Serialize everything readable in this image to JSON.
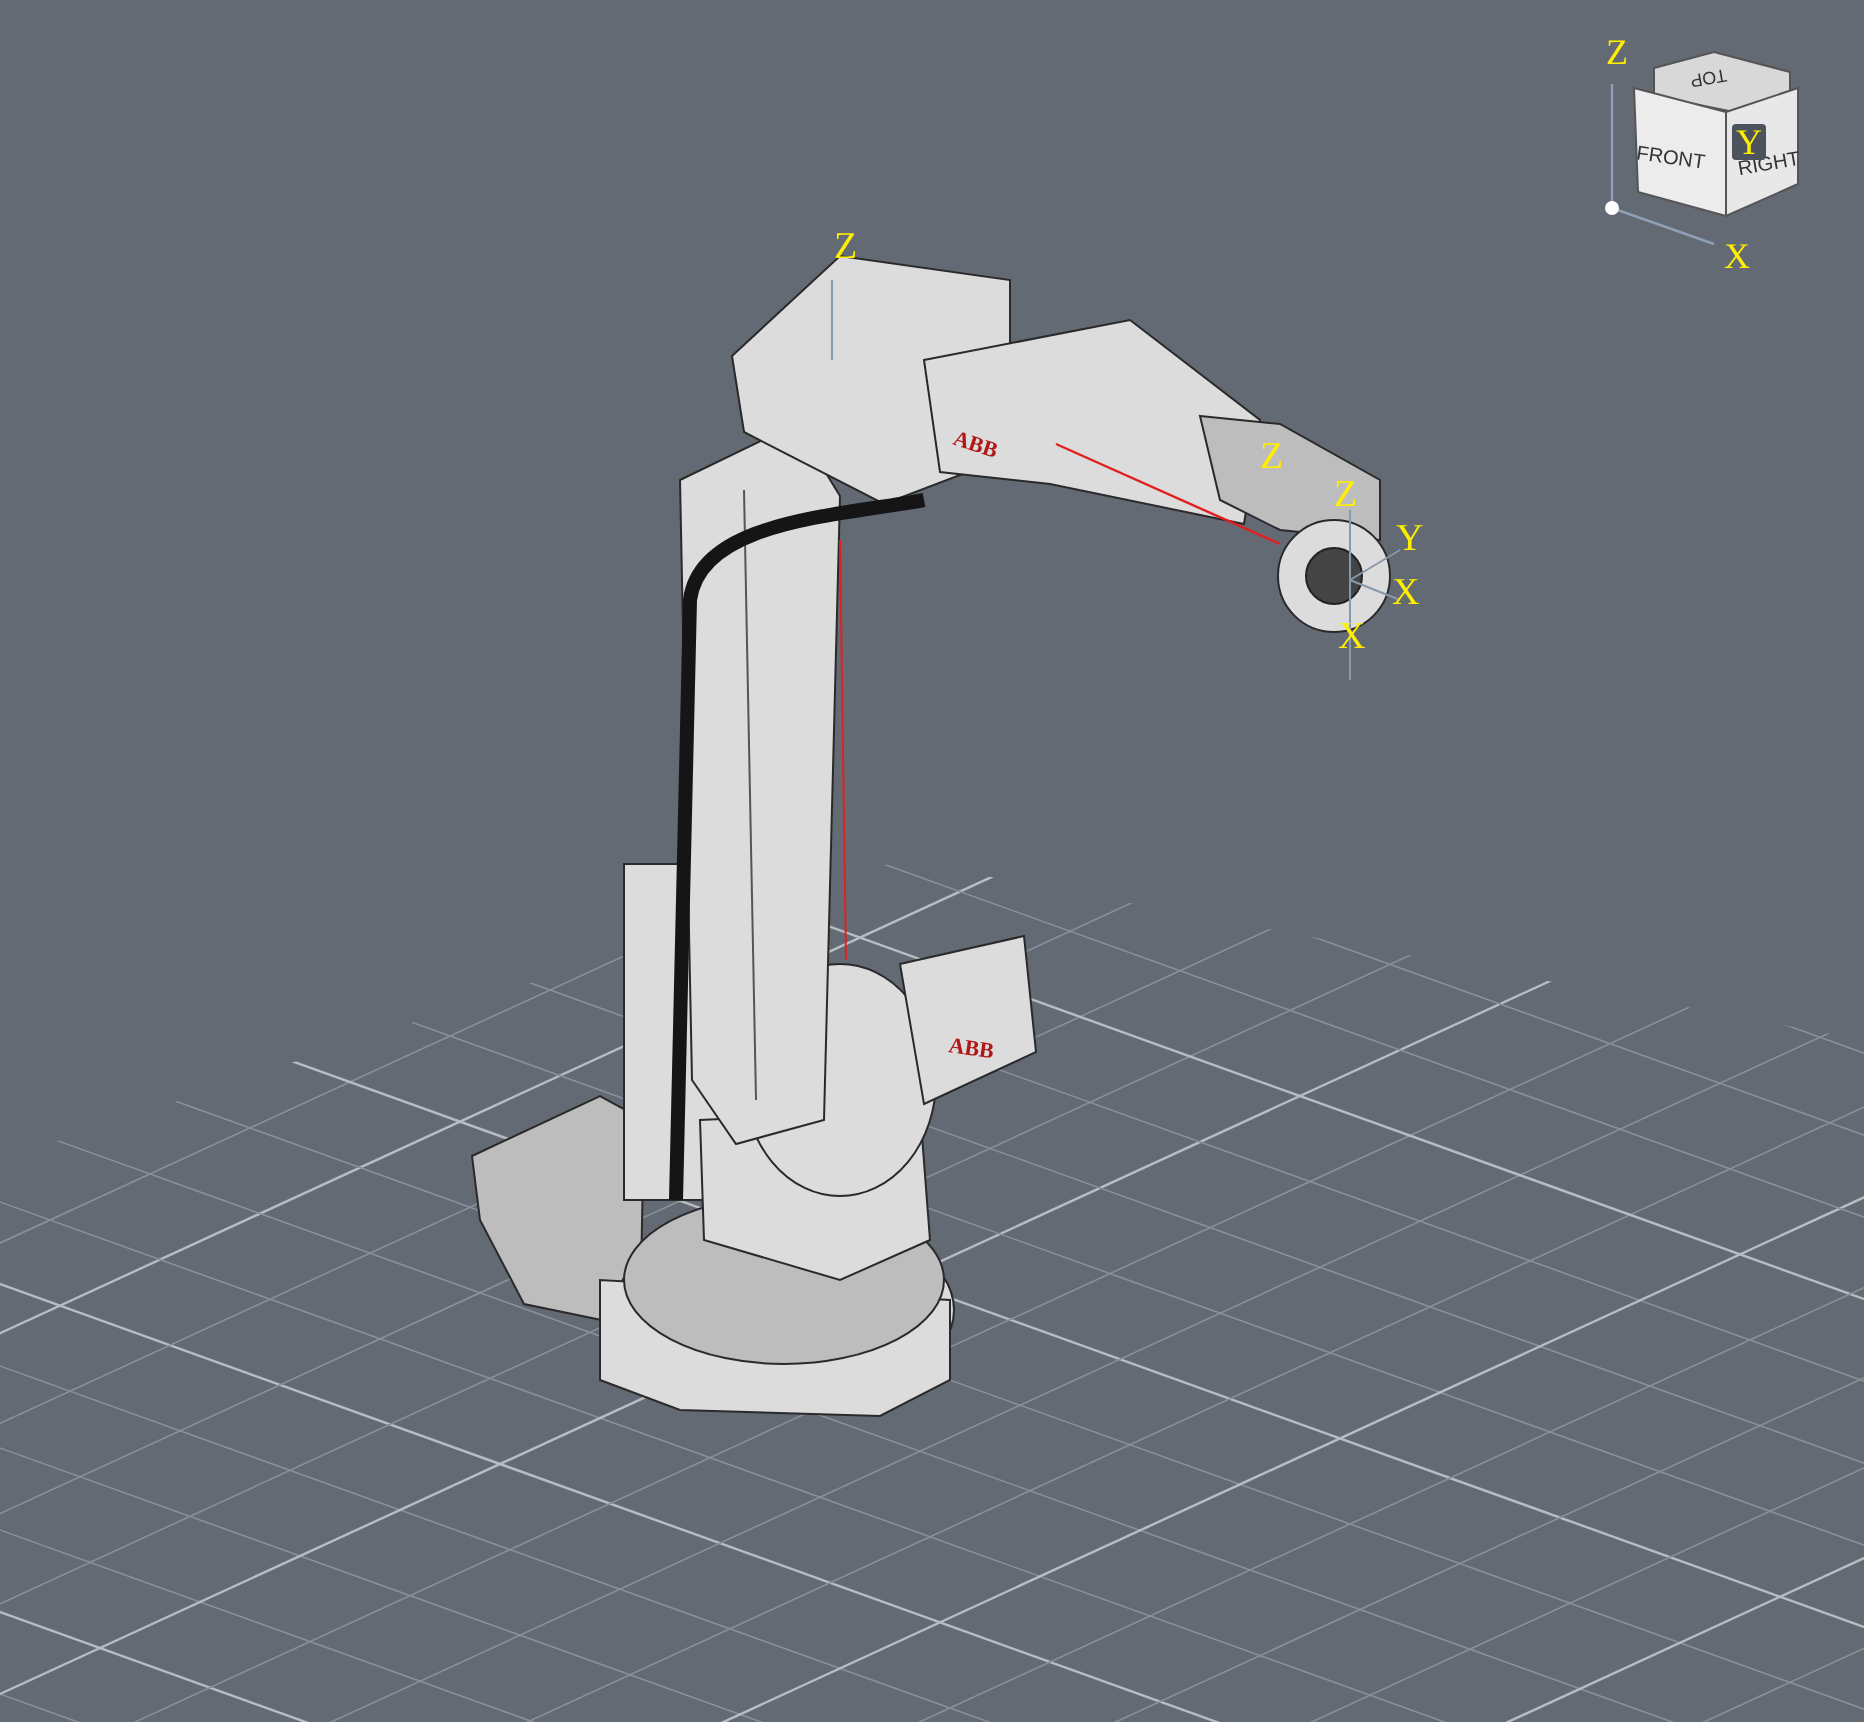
{
  "viewport": {
    "view_cube": {
      "faces": [
        {
          "kind": "top",
          "label": "TOP"
        },
        {
          "kind": "front",
          "label": "FRONT"
        },
        {
          "kind": "right",
          "label": "RIGHT"
        }
      ],
      "axes": [
        {
          "kind": "z",
          "label": "Z"
        },
        {
          "kind": "y",
          "label": "Y"
        },
        {
          "kind": "x",
          "label": "X"
        }
      ]
    },
    "frame_labels": [
      {
        "label": "Z"
      },
      {
        "label": "Z"
      },
      {
        "label": "Z"
      },
      {
        "label": "Y"
      },
      {
        "label": "X"
      },
      {
        "label": "X"
      }
    ],
    "model_logos": [
      "ABB",
      "ABB"
    ]
  }
}
